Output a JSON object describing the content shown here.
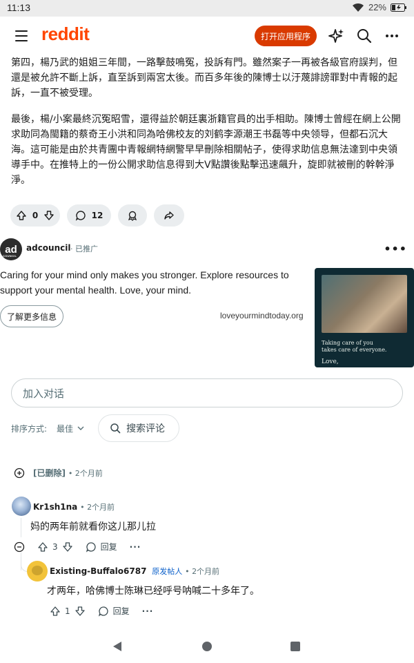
{
  "status_bar": {
    "time": "11:13",
    "battery": "22%"
  },
  "app_bar": {
    "logo": "reddit",
    "open_app_label": "打开应用程序",
    "brand_color": "#ff4500",
    "accent_color": "#d93a00"
  },
  "article": {
    "paragraphs": [
      "第四，楊乃武的姐姐三年間，一路擊鼓鳴冤，投訴有門。雖然案子一再被各級官府誤判，但還是被允許不斷上訴，直至訴到兩宮太後。而百多年後的陳博士以汙蔑誹謗罪對中青報的起訴，一直不被受理。",
      "最後，楊/小案最終沉冤昭雪，還得益於朝廷裏浙籍官員的出手相助。陳博士曾經在網上公開求助同為閩籍的蔡奇王小洪和同為哈佛校友的刘鹤李源潮王书磊等中央领导，但都石沉大海。這可能是由於共青團中青報網特網警早早刪除相關帖子，使得求助信息無法達到中央領導手中。在推特上的一份公開求助信息得到大V點讚後點擊迅速飆升，旋即就被刪的幹幹淨淨。"
    ]
  },
  "post_actions": {
    "vote_count": "0",
    "comment_count": "12"
  },
  "ad": {
    "logo_text": "ad",
    "logo_subtext": "COUNCIL",
    "advertiser": "adcouncil",
    "promoted_label": "· 已推广",
    "text": "Caring for your mind only makes you stronger. Explore resources to support your mental health. Love, your mind.",
    "cta": "了解更多信息",
    "domain": "loveyourmindtoday.org",
    "image_caption_line1": "Taking care of you",
    "image_caption_line2": "takes care of everyone.",
    "image_signoff": "Love,"
  },
  "conversation": {
    "placeholder": "加入对话"
  },
  "sort": {
    "label": "排序方式:",
    "value": "最佳",
    "search_label": "搜索评论"
  },
  "comments": [
    {
      "user": "[已删除]",
      "time": "• 2个月前"
    },
    {
      "user": "Kr1sh1na",
      "time": "• 2个月前",
      "text": "妈的两年前就看你这儿那儿拉",
      "votes": "3",
      "reply_label": "回复"
    },
    {
      "user": "Existing-Buffalo6787",
      "op_label": "原发帖人",
      "time": "• 2个月前",
      "text": "才两年，哈佛博士陈琳已经呼号呐喊二十多年了。",
      "votes": "1",
      "reply_label": "回复"
    }
  ]
}
